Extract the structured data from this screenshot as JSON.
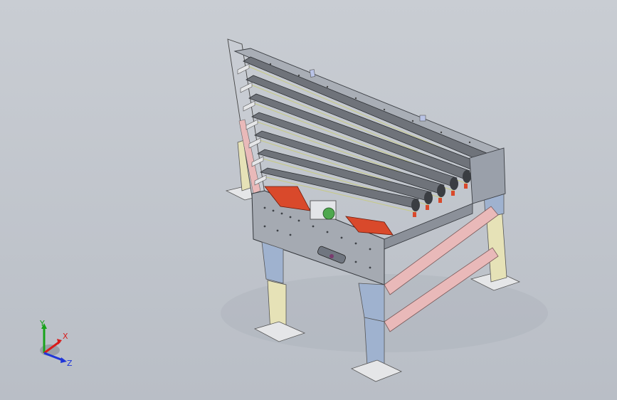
{
  "viewport": {
    "background_top": "#c9cdd3",
    "background_bottom": "#b9bec6"
  },
  "model": {
    "frame_color": "#9aa0aa",
    "frame_dark": "#5f646c",
    "belt_color": "#6f737a",
    "bracket_color": "#d9492b",
    "pink_color": "#e9b9b9",
    "leg_color": "#e6e2b7",
    "leg_blue": "#9fb2cf",
    "roller_count": 7
  },
  "triad": {
    "x_label": "X",
    "y_label": "Y",
    "z_label": "Z",
    "x_color": "#d81b1b",
    "y_color": "#18a31a",
    "z_color": "#1f35d8"
  }
}
